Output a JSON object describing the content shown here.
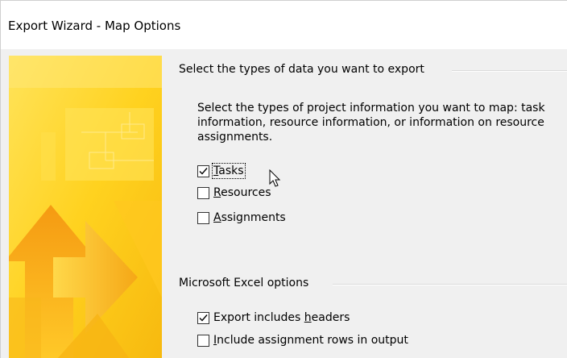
{
  "window": {
    "title": "Export Wizard - Map Options"
  },
  "data_group": {
    "label": "Select the types of data you want to export",
    "description": "Select the types of project information you want to map: task information, resource information, or information on resource assignments.",
    "options": [
      {
        "before": "",
        "mnemonic": "T",
        "after": "asks",
        "checked": true,
        "focused": true
      },
      {
        "before": "",
        "mnemonic": "R",
        "after": "esources",
        "checked": false,
        "focused": false
      },
      {
        "before": "",
        "mnemonic": "A",
        "after": "ssignments",
        "checked": false,
        "focused": false
      }
    ]
  },
  "excel_group": {
    "label": "Microsoft Excel options",
    "options": [
      {
        "before": "Export includes ",
        "mnemonic": "h",
        "after": "eaders",
        "checked": true,
        "focused": false
      },
      {
        "before": "",
        "mnemonic": "I",
        "after": "nclude assignment rows in output",
        "checked": false,
        "focused": false
      }
    ]
  },
  "icons": {
    "sidebar": "wizard-banner-graphic",
    "cursor": "mouse-pointer-icon",
    "check": "checkmark-icon"
  },
  "colors": {
    "banner_yellow": "#ffd21f",
    "banner_orange": "#f6a414",
    "dialog_bg": "#f0f0f0"
  }
}
